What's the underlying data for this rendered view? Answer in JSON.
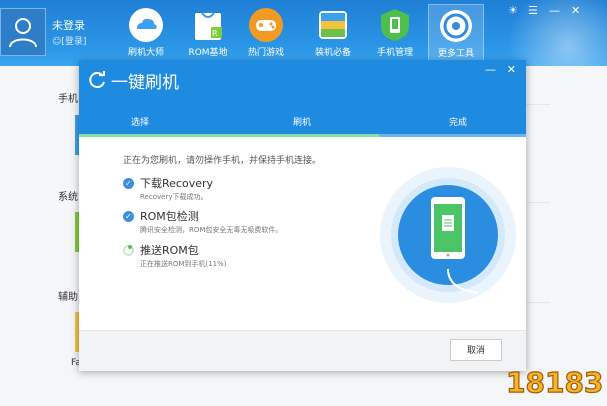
{
  "header": {
    "user": {
      "name": "未登录",
      "login_link": "[登录]"
    },
    "nav": [
      {
        "label": "刷机大师",
        "icon": "cloud-icon"
      },
      {
        "label": "ROM基地",
        "icon": "rom-bag-icon"
      },
      {
        "label": "热门游戏",
        "icon": "gamepad-icon"
      },
      {
        "label": "装机必备",
        "icon": "app-grid-icon"
      },
      {
        "label": "手机管理",
        "icon": "phone-icon"
      },
      {
        "label": "更多工具",
        "icon": "tools-icon"
      }
    ],
    "active_nav": "更多工具"
  },
  "background": {
    "sections": [
      "手机",
      "系统",
      "辅助"
    ],
    "footer_fragment": "Fa"
  },
  "dialog": {
    "title": "一键刷机",
    "steps": [
      {
        "label": "选择",
        "state": "done"
      },
      {
        "label": "刷机",
        "state": "current"
      },
      {
        "label": "完成",
        "state": "todo"
      }
    ],
    "status_message": "正在为您刷机，请勿操作手机，并保持手机连接。",
    "tasks": [
      {
        "title": "下载Recovery",
        "detail": "Recovery下载成功。",
        "state": "done"
      },
      {
        "title": "ROM包检测",
        "detail": "腾讯安全检测，ROM包安全无毒无吸费软件。",
        "state": "done"
      },
      {
        "title": "推送ROM包",
        "detail": "正在推送ROM到手机(11%)",
        "state": "in_progress",
        "progress_percent": 11
      }
    ],
    "cancel_label": "取消",
    "colors": {
      "accent": "#1e8be0",
      "step_done": "#7fe3a3",
      "check": "#3d8fd8",
      "phone_screen": "#4cc569"
    }
  },
  "watermark": "18183"
}
